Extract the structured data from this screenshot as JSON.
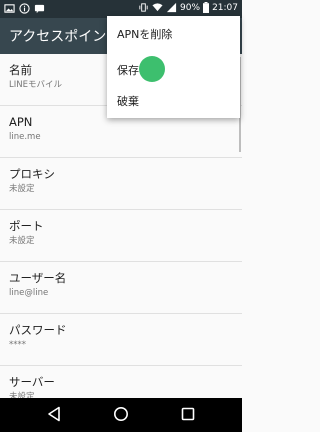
{
  "statusbar": {
    "battery": "90%",
    "time": "21:07"
  },
  "toolbar": {
    "title": "アクセスポイン"
  },
  "fields": [
    {
      "title": "名前",
      "value": "LINEモバイル"
    },
    {
      "title": "APN",
      "value": "line.me"
    },
    {
      "title": "プロキシ",
      "value": "未設定"
    },
    {
      "title": "ポート",
      "value": "未設定"
    },
    {
      "title": "ユーザー名",
      "value": "line@line"
    },
    {
      "title": "パスワード",
      "value": "****"
    },
    {
      "title": "サーバー",
      "value": "未設定"
    }
  ],
  "menu": {
    "delete_label": "APNを削除",
    "save_label": "保存",
    "discard_label": "破棄"
  },
  "colors": {
    "statusbar": "#263238",
    "toolbar": "#37474f",
    "touch": "#3dbf6e"
  }
}
